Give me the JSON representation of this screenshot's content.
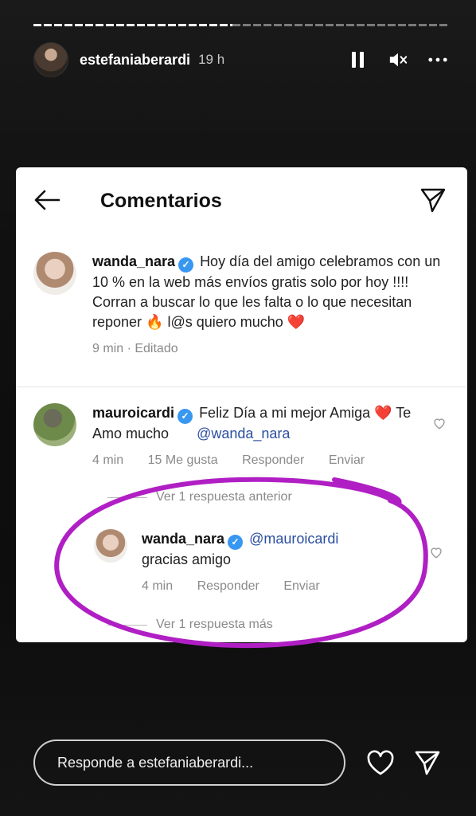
{
  "story": {
    "username": "estefaniaberardi",
    "time": "19 h",
    "progress": 0.48
  },
  "controls": [
    "pause-icon",
    "mute-icon",
    "more-icon"
  ],
  "card": {
    "title": "Comentarios",
    "post": {
      "username": "wanda_nara",
      "verified": true,
      "text": "Hoy día del amigo celebramos con un 10 % en la web más envíos gratis solo por hoy !!!! Corran a buscar lo que les falta o lo que necesitan reponer 🔥 l@s quiero mucho ❤️",
      "meta": "9 min · Editado"
    },
    "comments": [
      {
        "username": "mauroicardi",
        "verified": true,
        "text": "Feliz Día a mi mejor Amiga ❤️ Te Amo mucho",
        "mention": "@wanda_nara",
        "time": "4 min",
        "likes": "15 Me gusta",
        "reply": "Responder",
        "send": "Enviar"
      }
    ],
    "view_previous": "Ver 1 respuesta anterior",
    "reply": {
      "username": "wanda_nara",
      "verified": true,
      "mention": "@mauroicardi",
      "text": "gracias amigo",
      "time": "4 min",
      "reply": "Responder",
      "send": "Enviar"
    },
    "view_more": "Ver 1 respuesta más"
  },
  "reply_bar": {
    "placeholder": "Responde a estefaniaberardi..."
  },
  "colors": {
    "annotation": "#b01fc4",
    "verified": "#3897f0",
    "mention": "#2b4ea0"
  }
}
